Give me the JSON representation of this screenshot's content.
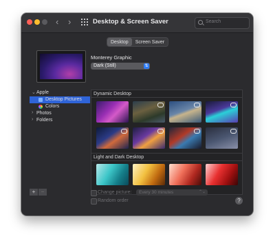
{
  "window": {
    "title": "Desktop & Screen Saver"
  },
  "search": {
    "placeholder": "Search"
  },
  "tabs": [
    {
      "label": "Desktop",
      "selected": true
    },
    {
      "label": "Screen Saver",
      "selected": false
    }
  ],
  "current": {
    "wallpaper_name": "Monterey Graphic",
    "appearance": "Dark (Still)"
  },
  "sidebar": {
    "items": [
      {
        "label": "Apple",
        "expanded": true
      },
      {
        "label": "Desktop Pictures",
        "selected": true
      },
      {
        "label": "Colors"
      },
      {
        "label": "Photos",
        "expanded": false
      },
      {
        "label": "Folders",
        "expanded": false
      }
    ]
  },
  "gallery": {
    "sections": [
      {
        "title": "Dynamic Desktop"
      },
      {
        "title": "Light and Dark Desktop"
      }
    ]
  },
  "options": {
    "change_picture": "Change picture:",
    "interval": "Every 30 minutes",
    "random_order": "Random order"
  },
  "buttons": {
    "add": "+",
    "remove": "−",
    "help": "?"
  },
  "glyphs": {
    "back": "‹",
    "forward": "›",
    "disclosure_open": "⌄",
    "disclosure_closed": "›",
    "popup_arrows": "⇅",
    "stepper": "⌃⌄"
  },
  "colors": {
    "close": "#ff5f57",
    "minimize": "#febc2e",
    "selection": "#2f64d8",
    "accent": "#2f7df6"
  }
}
